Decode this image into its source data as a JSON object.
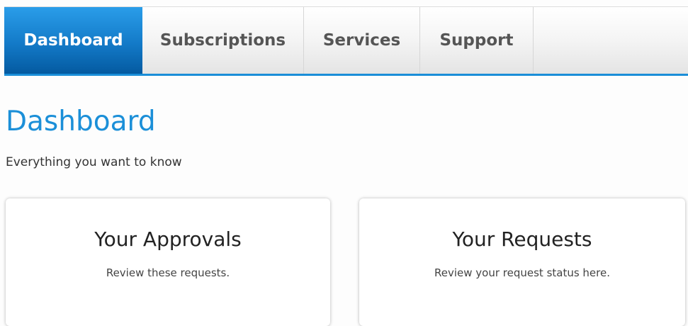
{
  "nav": {
    "tabs": [
      {
        "label": "Dashboard",
        "active": true
      },
      {
        "label": "Subscriptions",
        "active": false
      },
      {
        "label": "Services",
        "active": false
      },
      {
        "label": "Support",
        "active": false
      }
    ]
  },
  "page": {
    "title": "Dashboard",
    "subtitle": "Everything you want to know"
  },
  "cards": [
    {
      "title": "Your Approvals",
      "description": "Review these requests."
    },
    {
      "title": "Your Requests",
      "description": "Review your request status here."
    }
  ],
  "colors": {
    "accent": "#1b8fd8",
    "active_tab_top": "#2a9de9",
    "active_tab_bottom": "#045aa0"
  }
}
